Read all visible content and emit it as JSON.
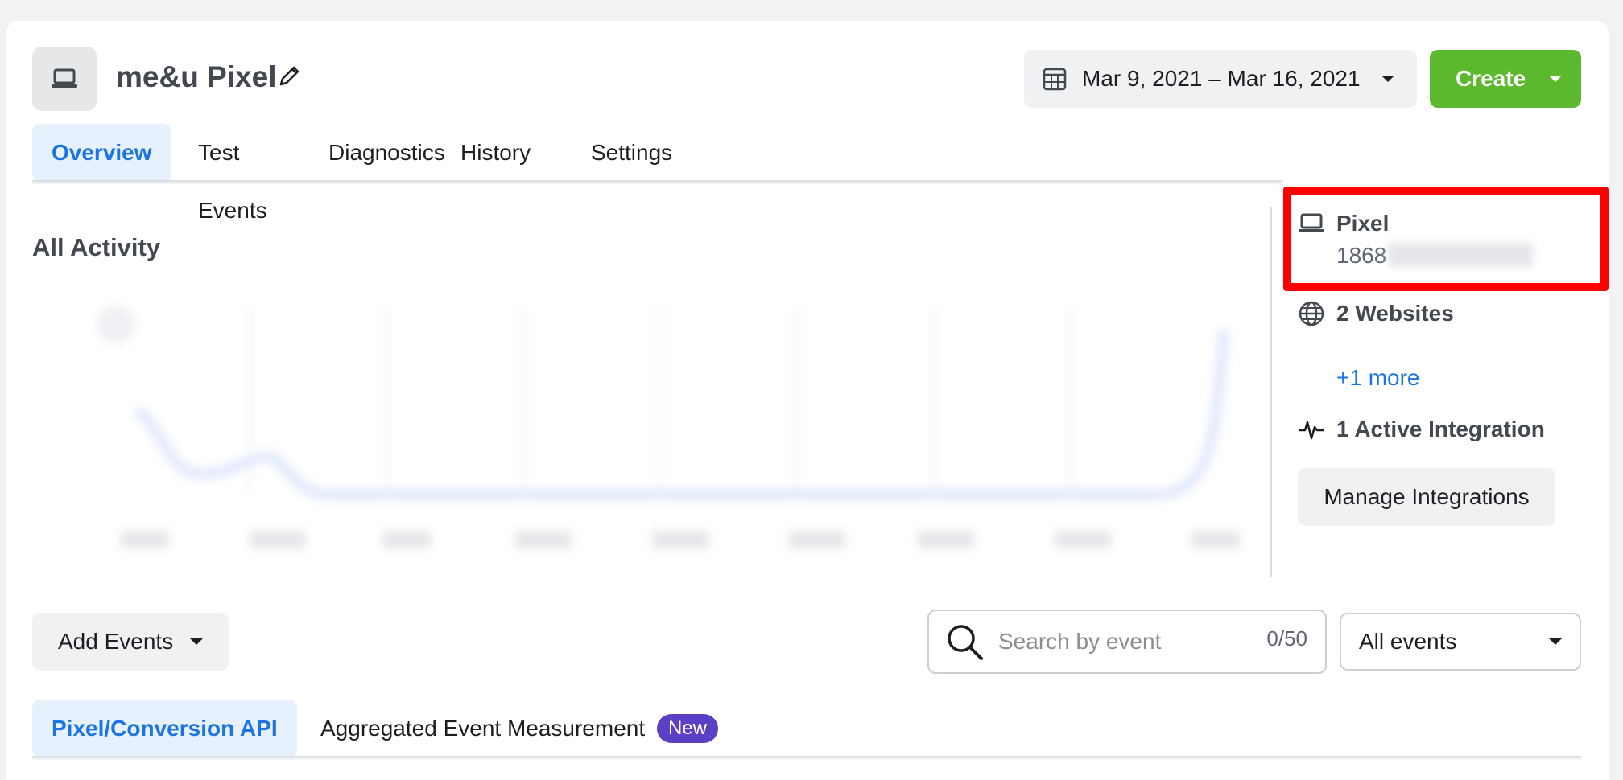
{
  "header": {
    "title": "me&u Pixel",
    "date_range": "Mar 9, 2021 – Mar 16, 2021",
    "create_label": "Create"
  },
  "tabs": [
    {
      "label": "Overview",
      "active": true
    },
    {
      "label": "Test Events",
      "active": false
    },
    {
      "label": "Diagnostics",
      "active": false
    },
    {
      "label": "History",
      "active": false
    },
    {
      "label": "Settings",
      "active": false
    }
  ],
  "activity": {
    "title": "All Activity"
  },
  "sidebar": {
    "pixel_label": "Pixel",
    "pixel_id": "1868",
    "websites_label": "2 Websites",
    "more_link": "+1 more",
    "integration_label": "1 Active Integration",
    "manage_button": "Manage Integrations"
  },
  "events": {
    "add_events_label": "Add Events",
    "search_placeholder": "Search by event",
    "search_count": "0/50",
    "filter_value": "All events"
  },
  "sub_tabs": [
    {
      "label": "Pixel/Conversion API",
      "active": true
    },
    {
      "label": "Aggregated Event Measurement",
      "active": false
    }
  ],
  "badge": "New",
  "colors": {
    "accent_blue": "#1b74e4",
    "create_green": "#5cb82c",
    "badge_purple": "#5b3fc4",
    "highlight_red": "#ff0000"
  }
}
